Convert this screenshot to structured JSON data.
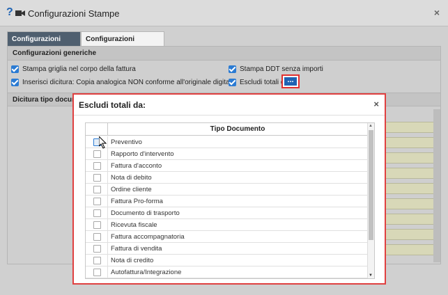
{
  "window": {
    "title": "Configurazioni Stampe",
    "help_icon": "?",
    "close_icon": "×"
  },
  "tabs": [
    {
      "label": "Configurazioni generiche",
      "active": true
    },
    {
      "label": "Configurazioni Ditta/Cliente",
      "active": false
    }
  ],
  "section": {
    "title": "Configurazioni generiche",
    "options": [
      {
        "label": "Stampa griglia nel corpo della fattura",
        "checked": true
      },
      {
        "label": "Stampa DDT senza importi",
        "checked": true
      },
      {
        "label": "Inserisci dicitura: Copia analogica NON conforme all'originale digitale",
        "checked": true
      },
      {
        "label": "Escludi totali da:",
        "checked": true
      }
    ],
    "dots_button": "..."
  },
  "dicitura": {
    "title": "Dicitura tipo documento"
  },
  "modal": {
    "title": "Escludi totali da:",
    "close_icon": "×",
    "column_header": "Tipo Documento",
    "rows": [
      {
        "label": "Preventivo",
        "checked": false
      },
      {
        "label": "Rapporto d'intervento",
        "checked": false
      },
      {
        "label": "Fattura d'acconto",
        "checked": false
      },
      {
        "label": "Nota di debito",
        "checked": false
      },
      {
        "label": "Ordine cliente",
        "checked": false
      },
      {
        "label": "Fattura Pro-forma",
        "checked": false
      },
      {
        "label": "Documento di trasporto",
        "checked": false
      },
      {
        "label": "Ricevuta fiscale",
        "checked": false
      },
      {
        "label": "Fattura accompagnatoria",
        "checked": false
      },
      {
        "label": "Fattura di vendita",
        "checked": false
      },
      {
        "label": "Nota di credito",
        "checked": false
      },
      {
        "label": "Autofattura/Integrazione",
        "checked": false
      }
    ]
  },
  "colors": {
    "accent": "#2b7bd3",
    "tab_active": "#4f5f6f",
    "highlight_border": "#e04040"
  }
}
